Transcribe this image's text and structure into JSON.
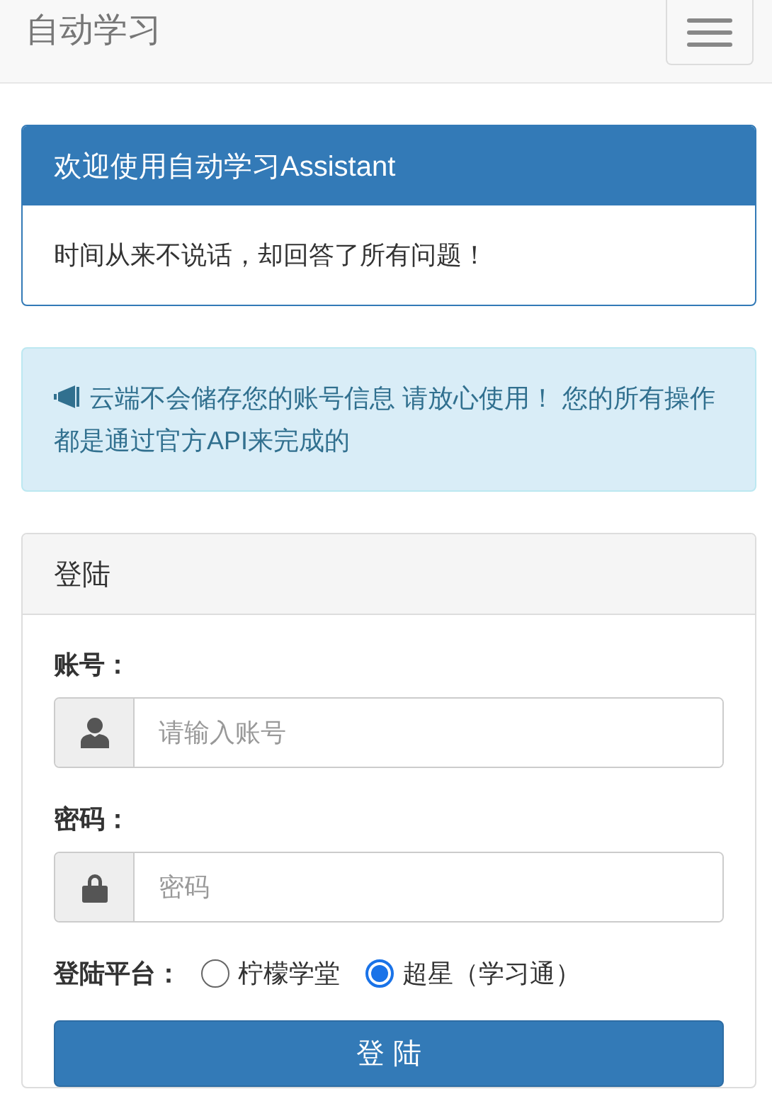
{
  "navbar": {
    "brand": "自动学习"
  },
  "welcome_panel": {
    "title": "欢迎使用自动学习Assistant",
    "body": "时间从来不说话，却回答了所有问题！"
  },
  "notice": {
    "text": "云端不会储存您的账号信息 请放心使用！ 您的所有操作都是通过官方API来完成的"
  },
  "login_panel": {
    "title": "登陆",
    "fields": [
      {
        "kind": "user",
        "label": "账号：",
        "placeholder": "请输入账号"
      },
      {
        "kind": "lock",
        "label": "密码：",
        "placeholder": "密码"
      }
    ],
    "platform": {
      "label": "登陆平台：",
      "options": [
        {
          "label": "柠檬学堂",
          "selected": false
        },
        {
          "label": "超星（学习通）",
          "selected": true
        }
      ]
    },
    "submit": "登 陆"
  }
}
